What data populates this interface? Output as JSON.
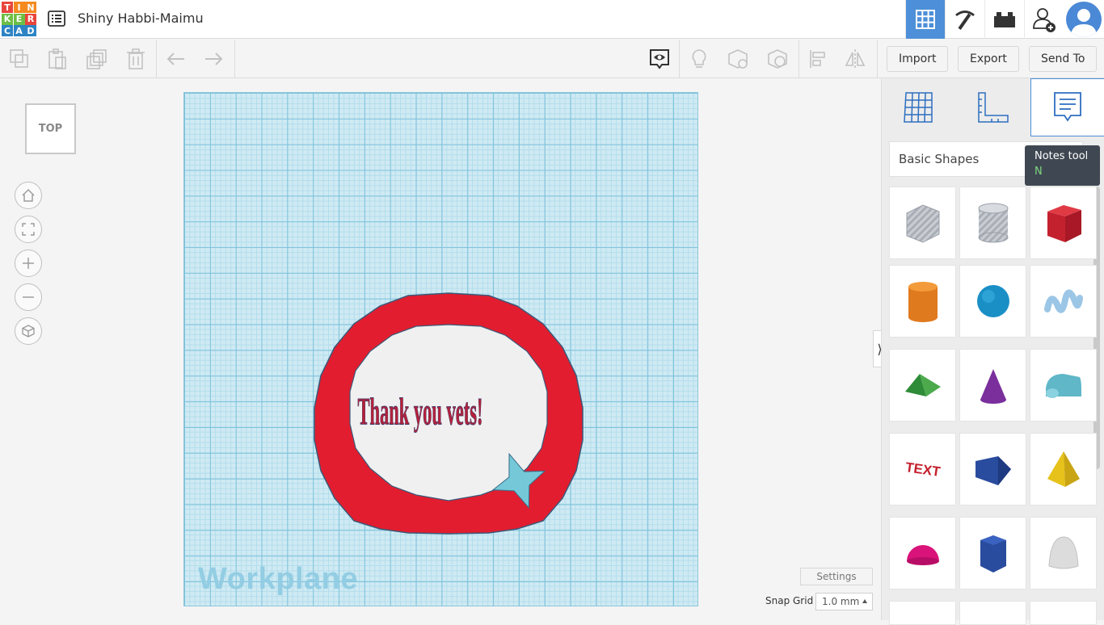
{
  "header": {
    "logo_letters": [
      "T",
      "I",
      "N",
      "K",
      "E",
      "R",
      "C",
      "A",
      "D"
    ],
    "logo_colors": [
      "#e8453c",
      "#f58a1f",
      "#f58a1f",
      "#6cbf44",
      "#6cbf44",
      "#e8453c",
      "#2d84c4",
      "#2d84c4",
      "#2d84c4"
    ],
    "project_title": "Shiny Habbi-Maimu",
    "view_buttons": [
      {
        "icon": "grid-view-icon",
        "active": true
      },
      {
        "icon": "pickaxe-icon",
        "active": false
      },
      {
        "icon": "bricks-icon",
        "active": false
      },
      {
        "icon": "add-user-icon",
        "active": false
      }
    ],
    "accent_color": "#4d8fd8"
  },
  "toolbar": {
    "import_label": "Import",
    "export_label": "Export",
    "send_to_label": "Send To"
  },
  "canvas": {
    "viewcube_label": "TOP",
    "workplane_label": "Workplane",
    "settings_label": "Settings",
    "snap_grid_label": "Snap Grid",
    "snap_grid_value": "1.0 mm",
    "design_text": "Thank you vets!"
  },
  "panel": {
    "tabs": [
      "workplane-tool",
      "ruler-tool",
      "notes-tool"
    ],
    "shape_category": "Basic Shapes",
    "tooltip_title": "Notes tool",
    "tooltip_key": "N",
    "shapes": [
      "box-hole",
      "cylinder-hole",
      "box",
      "cylinder",
      "sphere",
      "scribble",
      "roof",
      "cone",
      "round-roof",
      "text",
      "half-cylinder-wedge",
      "pyramid",
      "half-sphere",
      "polygon",
      "paraboloid"
    ]
  }
}
